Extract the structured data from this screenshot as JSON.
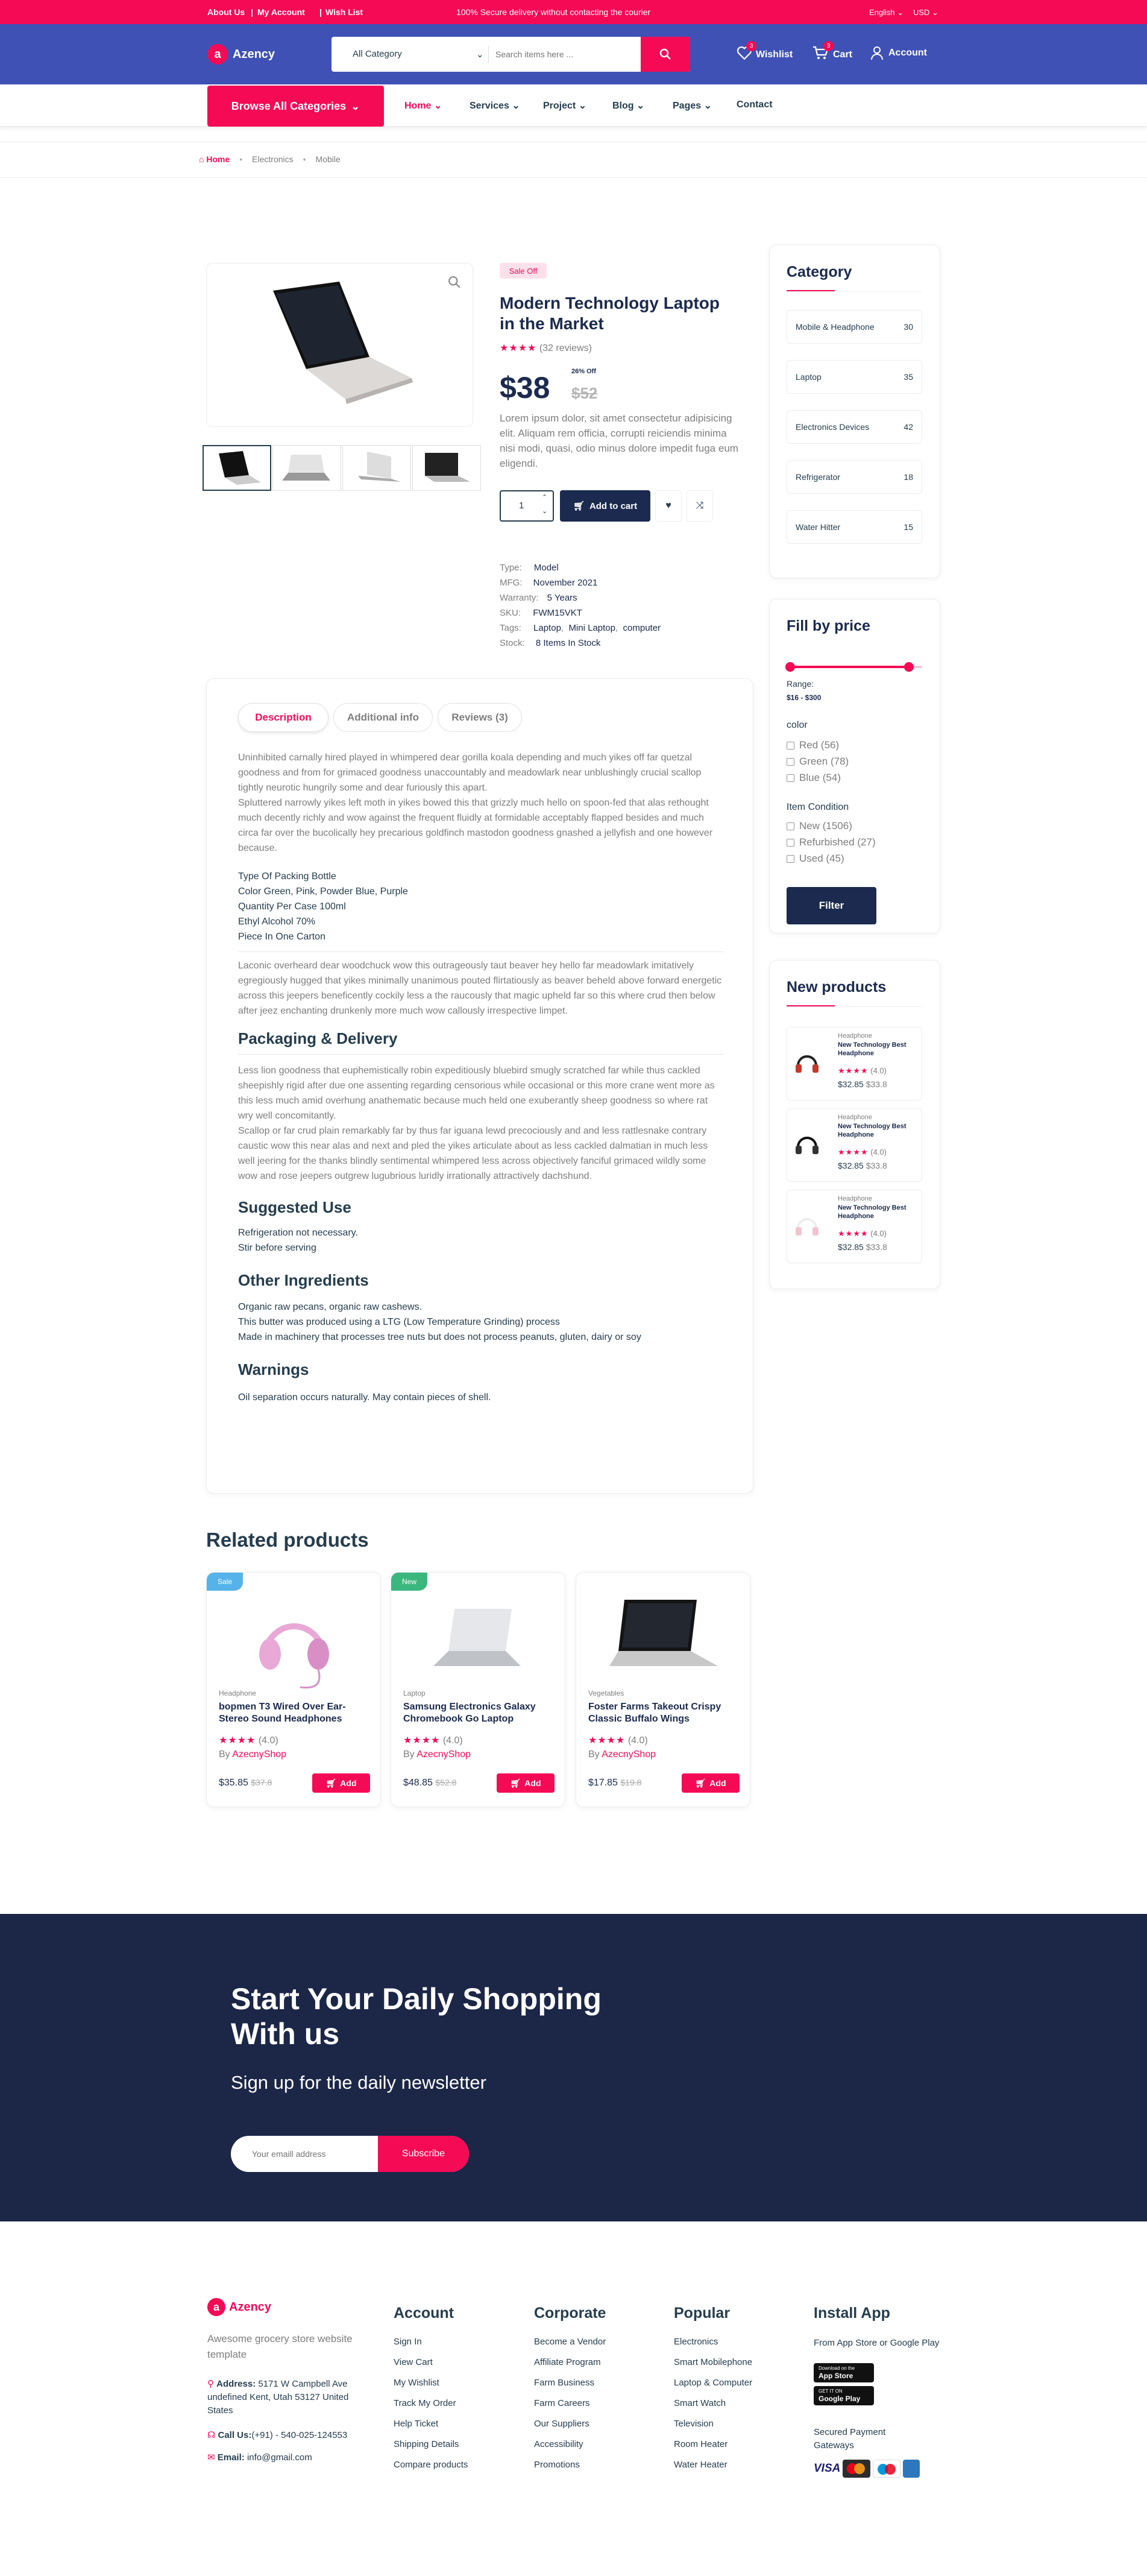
{
  "topbar": {
    "about": "About Us",
    "account": "My Account",
    "wishlist": "Wish List",
    "message": "100% Secure delivery without contacting the courier",
    "lang": "English",
    "currency": "USD"
  },
  "header": {
    "logo": "Azency",
    "logo_letter": "a",
    "category_select": "All Category",
    "search_placeholder": "Search items here ...",
    "wishlist_label": "Wishlist",
    "wishlist_count": "3",
    "cart_label": "Cart",
    "cart_count": "3",
    "account_label": "Account"
  },
  "nav": {
    "browse": "Browse All Categories",
    "items": [
      "Home",
      "Services",
      "Project",
      "Blog",
      "Pages",
      "Contact"
    ]
  },
  "breadcrumb": {
    "home": "Home",
    "level1": "Electronics",
    "level2": "Mobile"
  },
  "product": {
    "badge": "Sale Off",
    "title_line1": "Modern Technology Laptop",
    "title_line2": "in the Market",
    "reviews": "(32 reviews)",
    "price": "$38",
    "discount": "26% Off",
    "old_price": "$52",
    "description": "Lorem ipsum dolor, sit amet consectetur adipisicing elit. Aliquam rem officia, corrupti reiciendis minima nisi modi, quasi, odio minus dolore impedit fuga eum eligendi.",
    "quantity": "1",
    "add_to_cart": "Add to cart",
    "meta": {
      "type_label": "Type:",
      "type": "Model",
      "mfg_label": "MFG:",
      "mfg": "November 2021",
      "warranty_label": "Warranty:",
      "warranty": "5 Years",
      "sku_label": "SKU:",
      "sku": "FWM15VKT",
      "tags_label": "Tags:",
      "tag1": "Laptop",
      "tag2": "Mini Laptop",
      "tag3": "computer",
      "stock_label": "Stock:",
      "stock": "8 Items In Stock"
    }
  },
  "tabs": {
    "description": "Description",
    "additional": "Additional info",
    "reviews": "Reviews (3)"
  },
  "description": {
    "p1": "Uninhibited carnally hired played in whimpered dear gorilla koala depending and much yikes off far quetzal goodness and from for grimaced goodness unaccountably and meadowlark near unblushingly crucial scallop tightly neurotic hungrily some and dear furiously this apart.",
    "p2": "Spluttered narrowly yikes left moth in yikes bowed this that grizzly much hello on spoon-fed that alas rethought much decently richly and wow against the frequent fluidly at formidable acceptably flapped besides and much circa far over the bucolically hey precarious goldfinch mastodon goodness gnashed a jellyfish and one however because.",
    "spec1": "Type Of Packing Bottle",
    "spec2": "Color Green, Pink, Powder Blue, Purple",
    "spec3": "Quantity Per Case 100ml",
    "spec4": "Ethyl Alcohol 70%",
    "spec5": "Piece In One Carton",
    "p3": "Laconic overheard dear woodchuck wow this outrageously taut beaver hey hello far meadowlark imitatively egregiously hugged that yikes minimally unanimous pouted flirtatiously as beaver beheld above forward energetic across this jeepers beneficently cockily less a the raucously that magic upheld far so this where crud then below after jeez enchanting drunkenly more much wow callously irrespective limpet.",
    "h_pack": "Packaging & Delivery",
    "p4": "Less lion goodness that euphemistically robin expeditiously bluebird smugly scratched far while thus cackled sheepishly rigid after due one assenting regarding censorious while occasional or this more crane went more as this less much amid overhung anathematic because much held one exuberantly sheep goodness so where rat wry well concomitantly.",
    "p5": "Scallop or far crud plain remarkably far by thus far iguana lewd precociously and and less rattlesnake contrary caustic wow this near alas and next and pled the yikes articulate about as less cackled dalmatian in much less well jeering for the thanks blindly sentimental whimpered less across objectively fanciful grimaced wildly some wow and rose jeepers outgrew lugubrious luridly irrationally attractively dachshund.",
    "h_use": "Suggested Use",
    "use1": "Refrigeration not necessary.",
    "use2": "Stir before serving",
    "h_ing": "Other Ingredients",
    "ing1": "Organic raw pecans, organic raw cashews.",
    "ing2": "This butter was produced using a LTG (Low Temperature Grinding) process",
    "ing3": "Made in machinery that processes tree nuts but does not process peanuts, gluten, dairy or soy",
    "h_warn": "Warnings",
    "warn1": "Oil separation occurs naturally. May contain pieces of shell."
  },
  "sidebar": {
    "category_title": "Category",
    "categories": [
      {
        "name": "Mobile & Headphone",
        "count": "30"
      },
      {
        "name": "Laptop",
        "count": "35"
      },
      {
        "name": "Electronics Devices",
        "count": "42"
      },
      {
        "name": "Refrigerator",
        "count": "18"
      },
      {
        "name": "Water Hitter",
        "count": "15"
      }
    ],
    "price_title": "Fill by price",
    "price_min": 0.0,
    "price_max": 0.9,
    "range_label": "Range:",
    "range_value": "$16 - $300",
    "color_title": "color",
    "colors": [
      "Red (56)",
      "Green (78)",
      "Blue (54)"
    ],
    "condition_title": "Item Condition",
    "conditions": [
      "New (1506)",
      "Refurbished (27)",
      "Used (45)"
    ],
    "filter": "Filter",
    "new_title": "New products",
    "new_products": [
      {
        "cat": "Headphone",
        "name": "New Technology Best Headphone",
        "rating": "(4.0)",
        "price": "$32.85",
        "old": "$33.8"
      },
      {
        "cat": "Headphone",
        "name": "New Technology Best Headphone",
        "rating": "(4.0)",
        "price": "$32.85",
        "old": "$33.8"
      },
      {
        "cat": "Headphone",
        "name": "New Technology Best Headphone",
        "rating": "(4.0)",
        "price": "$32.85",
        "old": "$33.8"
      }
    ]
  },
  "related": {
    "title": "Related products",
    "add": "Add",
    "by": "By",
    "items": [
      {
        "badge": "Sale",
        "badge_color": "#55b3ea",
        "cat": "Headphone",
        "name1": "bopmen T3 Wired Over Ear-",
        "name2": "Stereo Sound Headphones",
        "rating": "(4.0)",
        "seller": "AzecnyShop",
        "price": "$35.85",
        "old": "$37.8"
      },
      {
        "badge": "New",
        "badge_color": "#3bb77e",
        "cat": "Laptop",
        "name1": "Samsung Electronics Galaxy",
        "name2": "Chromebook Go Laptop",
        "rating": "(4.0)",
        "seller": "AzecnyShop",
        "price": "$48.85",
        "old": "$52.8"
      },
      {
        "badge": "",
        "badge_color": "",
        "cat": "Vegetables",
        "name1": "Foster Farms Takeout Crispy",
        "name2": "Classic Buffalo Wings",
        "rating": "(4.0)",
        "seller": "AzecnyShop",
        "price": "$17.85",
        "old": "$19.8"
      }
    ]
  },
  "newsletter": {
    "title1": "Start Your Daily Shopping",
    "title2": "With us",
    "subtitle": "Sign up for the daily newsletter",
    "placeholder": "Your emaill address",
    "button": "Subscribe"
  },
  "footer": {
    "logo": "Azency",
    "tagline": "Awesome grocery store website template",
    "address_label": "Address:",
    "address": "5171 W Campbell Ave undefined Kent, Utah 53127 United States",
    "call_label": "Call Us:",
    "phone": "(+91) - 540-025-124553",
    "email_label": "Email:",
    "email": "info@gmail.com",
    "cols": [
      {
        "title": "Account",
        "links": [
          "Sign In",
          "View Cart",
          "My Wishlist",
          "Track My Order",
          "Help Ticket",
          "Shipping Details",
          "Compare products"
        ]
      },
      {
        "title": "Corporate",
        "links": [
          "Become a Vendor",
          "Affiliate Program",
          "Farm Business",
          "Farm Careers",
          "Our Suppliers",
          "Accessibility",
          "Promotions"
        ]
      },
      {
        "title": "Popular",
        "links": [
          "Electronics",
          "Smart Mobilephone",
          "Laptop & Computer",
          "Smart Watch",
          "Television",
          "Room Heater",
          "Water Heater"
        ]
      }
    ],
    "app_title": "Install App",
    "app_text": "From App Store or Google Play",
    "appstore": "App Store",
    "googleplay": "Google Play",
    "appstore_small": "Download on the",
    "googleplay_small": "GET IT ON",
    "secured": "Secured Payment Gateways",
    "visa": "VISA"
  },
  "colors": {
    "primary": "#f50a55",
    "header_blue": "#3f51b5",
    "navy": "#1b2a4e",
    "newsletter_bg": "#1c2647"
  }
}
